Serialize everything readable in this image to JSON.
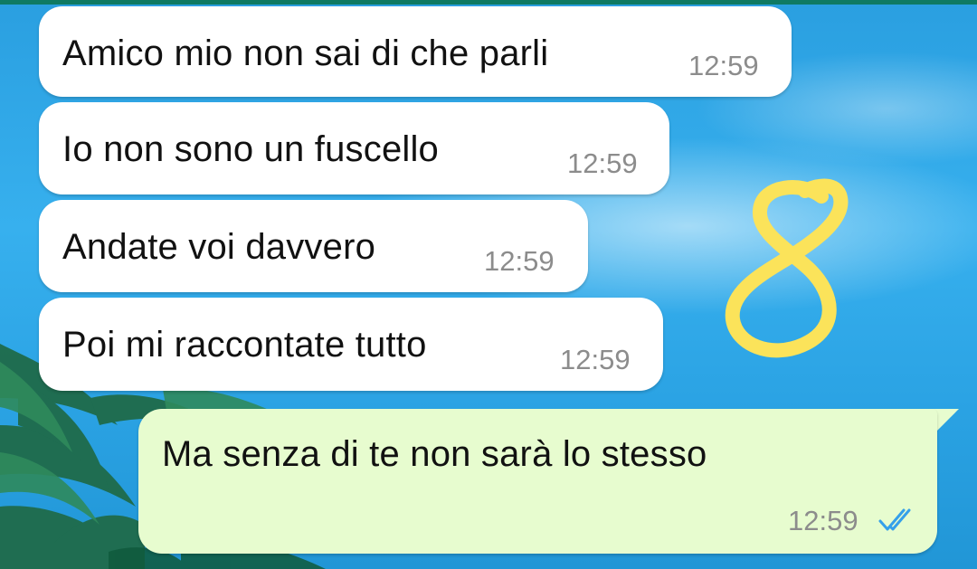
{
  "chat": {
    "messages": [
      {
        "direction": "incoming",
        "text": "Amico mio non sai di che parli",
        "time": "12:59"
      },
      {
        "direction": "incoming",
        "text": "Io non sono un fuscello",
        "time": "12:59"
      },
      {
        "direction": "incoming",
        "text": "Andate voi davvero",
        "time": "12:59"
      },
      {
        "direction": "incoming",
        "text": "Poi mi raccontate tutto",
        "time": "12:59"
      },
      {
        "direction": "outgoing",
        "text": "Ma senza di te non sarà lo stesso",
        "time": "12:59",
        "status": "read"
      }
    ]
  },
  "overlay": {
    "handwritten_mark": "8",
    "mark_color": "#fbe35a"
  },
  "colors": {
    "incoming_bubble": "#ffffff",
    "outgoing_bubble": "#e7fccf",
    "read_ticks": "#34a0ea",
    "timestamp": "#8c8c8c",
    "top_strip": "#0f7a62"
  }
}
